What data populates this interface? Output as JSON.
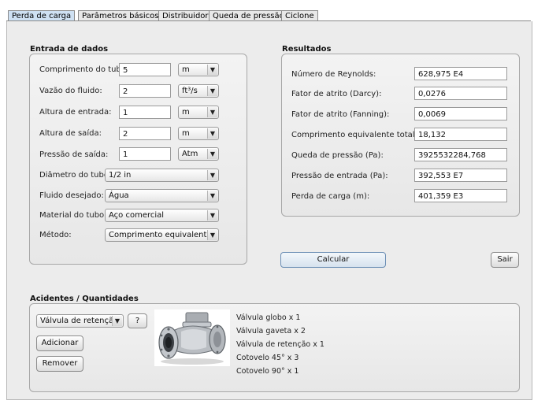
{
  "tabs": [
    {
      "label": "Perda de carga",
      "active": true
    },
    {
      "label": "Parâmetros básicos",
      "active": false
    },
    {
      "label": "Distribuidor",
      "active": false
    },
    {
      "label": "Queda de pressão",
      "active": false
    },
    {
      "label": "Ciclone",
      "active": false
    }
  ],
  "entrada": {
    "title": "Entrada de dados",
    "comprimento": {
      "label": "Comprimento do tubo:",
      "value": "5",
      "unit": "m"
    },
    "vazao": {
      "label": "Vazão do fluido:",
      "value": "2",
      "unit": "ft³/s"
    },
    "altura_entrada": {
      "label": "Altura de entrada:",
      "value": "1",
      "unit": "m"
    },
    "altura_saida": {
      "label": "Altura de saída:",
      "value": "2",
      "unit": "m"
    },
    "pressao_saida": {
      "label": "Pressão de saída:",
      "value": "1",
      "unit": "Atm"
    },
    "diametro": {
      "label": "Diâmetro do tubo:",
      "value": "1/2 in"
    },
    "fluido": {
      "label": "Fluido desejado:",
      "value": "Água"
    },
    "material": {
      "label": "Material do tubo:",
      "value": "Aço comercial"
    },
    "metodo": {
      "label": "Método:",
      "value": "Comprimento equivalente"
    }
  },
  "resultados": {
    "title": "Resultados",
    "items": [
      {
        "label": "Número de Reynolds:",
        "value": "628,975 E4"
      },
      {
        "label": "Fator de atrito (Darcy):",
        "value": "0,0276"
      },
      {
        "label": "Fator de atrito (Fanning):",
        "value": "0,0069"
      },
      {
        "label": "Comprimento equivalente total (m):",
        "value": "18,132"
      },
      {
        "label": "Queda de pressão (Pa):",
        "value": "3925532284,768"
      },
      {
        "label": "Pressão de entrada (Pa):",
        "value": "392,553 E7"
      },
      {
        "label": "Perda de carga (m):",
        "value": "401,359 E3"
      }
    ]
  },
  "buttons": {
    "calcular": "Calcular",
    "sair": "Sair",
    "adicionar": "Adicionar",
    "remover": "Remover",
    "help": "?"
  },
  "acidentes": {
    "title": "Acidentes / Quantidades",
    "selected": "Válvula de retenção",
    "list": [
      "Válvula globo x 1",
      "Válvula gaveta x 2",
      "Válvula de retenção x 1",
      "Cotovelo 45° x 3",
      "Cotovelo 90° x 1"
    ]
  },
  "icons": {
    "dropdown": "chevron-down-icon",
    "valve": "check-valve-image"
  },
  "colors": {
    "active_tab": "#cfe1f3",
    "panel": "#ececec",
    "border": "#a7a7a7"
  }
}
